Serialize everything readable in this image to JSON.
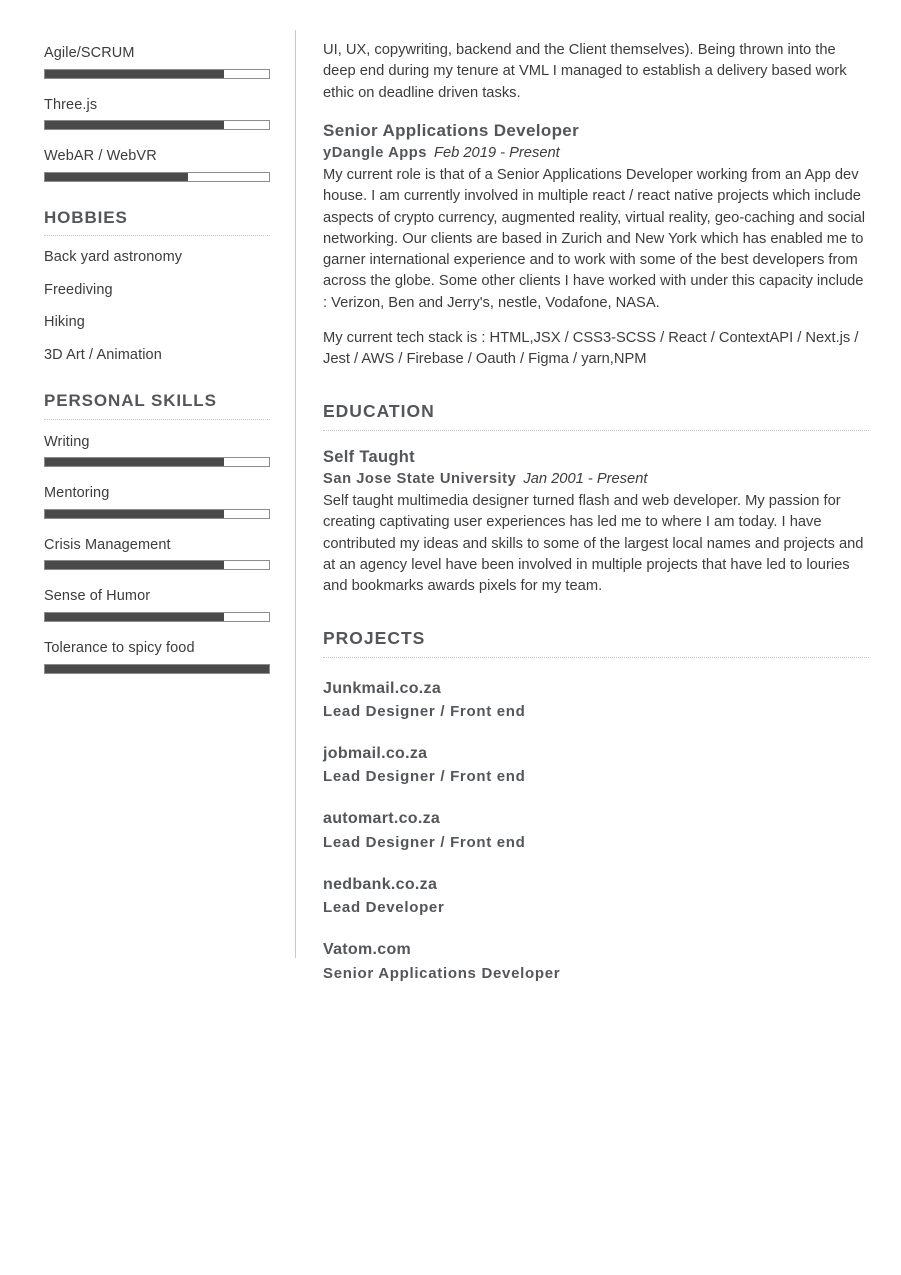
{
  "theme": {
    "bar_fill_color": "#4a4a4a",
    "bar_border_color": "#8c8c8c",
    "heading_color": "#53565a",
    "text_color": "#3c3c3c",
    "divider_color": "#c9c9c9"
  },
  "left_column": {
    "top_skills": [
      {
        "label": "Agile/SCRUM",
        "percent": 80
      },
      {
        "label": "Three.js",
        "percent": 80
      },
      {
        "label": "WebAR / WebVR",
        "percent": 64
      }
    ],
    "hobbies": {
      "heading": "HOBBIES",
      "items": [
        "Back yard astronomy",
        "Freediving",
        "Hiking",
        "3D Art / Animation"
      ]
    },
    "personal_skills": {
      "heading": "PERSONAL SKILLS",
      "items": [
        {
          "label": "Writing",
          "percent": 80
        },
        {
          "label": "Mentoring",
          "percent": 80
        },
        {
          "label": "Crisis Management",
          "percent": 80
        },
        {
          "label": "Sense of Humor",
          "percent": 80
        },
        {
          "label": "Tolerance to spicy food",
          "percent": 100
        }
      ]
    }
  },
  "right_column": {
    "continued_paragraph": "UI, UX, copywriting, backend and the Client themselves). Being thrown into the deep end during my tenure at VML I managed to establish a delivery based work ethic on deadline driven tasks.",
    "current_job": {
      "title": "Senior Applications Developer",
      "organization": "yDangle Apps",
      "dates": "Feb 2019 - Present",
      "description": "My current role is that of a Senior Applications Developer working from an App dev house. I am currently involved in multiple react / react native projects which include aspects of crypto currency, augmented reality, virtual reality, geo-caching and social networking. Our clients are based in Zurich and New York which has enabled me to garner international experience and to work with some of the best developers from across the globe. Some other clients I have worked with under this capacity include : Verizon, Ben and Jerry's, nestle, Vodafone, NASA.",
      "tech_stack": "My current tech stack is : HTML,JSX / CSS3-SCSS / React / ContextAPI / Next.js / Jest / AWS / Firebase / Oauth / Figma / yarn,NPM"
    },
    "education": {
      "heading": "EDUCATION",
      "entry": {
        "title": "Self Taught",
        "organization": "San Jose State University",
        "dates": "Jan 2001 - Present",
        "description": "Self taught multimedia designer turned flash and web developer. My passion for creating captivating user experiences has led me to where I am today. I have contributed my ideas and skills to some of the largest local names and projects and at an agency level have been involved in multiple projects that have led to louries and bookmarks awards pixels for my team."
      }
    },
    "projects": {
      "heading": "PROJECTS",
      "items": [
        {
          "name": "Junkmail.co.za",
          "role": "Lead Designer / Front end"
        },
        {
          "name": "jobmail.co.za",
          "role": "Lead Designer / Front end"
        },
        {
          "name": "automart.co.za",
          "role": "Lead Designer / Front end"
        },
        {
          "name": "nedbank.co.za",
          "role": "Lead Developer"
        },
        {
          "name": "Vatom.com",
          "role": "Senior Applications Developer"
        }
      ]
    }
  }
}
